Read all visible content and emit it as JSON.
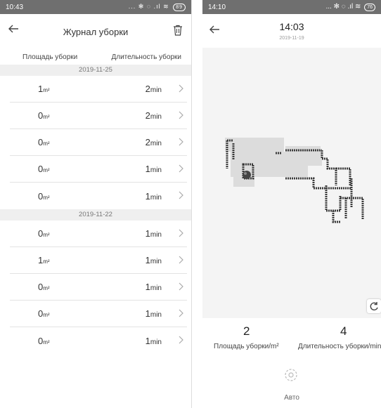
{
  "left_screen": {
    "status_time": "10:43",
    "status_icons": "... ✻ ◌ .ıl ≋",
    "battery": "89",
    "title": "Журнал уборки",
    "col_area": "Площадь уборки",
    "col_duration": "Длительность уборки",
    "groups": [
      {
        "date": "2019-11-25",
        "rows": [
          {
            "area": "1",
            "area_unit": "m²",
            "duration": "2",
            "duration_unit": "min"
          },
          {
            "area": "0",
            "area_unit": "m²",
            "duration": "2",
            "duration_unit": "min"
          },
          {
            "area": "0",
            "area_unit": "m²",
            "duration": "2",
            "duration_unit": "min"
          },
          {
            "area": "0",
            "area_unit": "m²",
            "duration": "1",
            "duration_unit": "min"
          },
          {
            "area": "0",
            "area_unit": "m²",
            "duration": "1",
            "duration_unit": "min"
          }
        ]
      },
      {
        "date": "2019-11-22",
        "rows": [
          {
            "area": "0",
            "area_unit": "m²",
            "duration": "1",
            "duration_unit": "min"
          },
          {
            "area": "1",
            "area_unit": "m²",
            "duration": "1",
            "duration_unit": "min"
          },
          {
            "area": "0",
            "area_unit": "m²",
            "duration": "1",
            "duration_unit": "min"
          },
          {
            "area": "0",
            "area_unit": "m²",
            "duration": "1",
            "duration_unit": "min"
          },
          {
            "area": "0",
            "area_unit": "m²",
            "duration": "1",
            "duration_unit": "min"
          }
        ]
      }
    ]
  },
  "right_screen": {
    "status_time": "14:10",
    "status_icons": "... ✻ ◌ .ıl ≋",
    "battery": "76",
    "time": "14:03",
    "date": "2019-11-19",
    "area_value": "2",
    "area_label": "Площадь уборки/m²",
    "duration_value": "4",
    "duration_label": "Длительность уборки/min",
    "mode_label": "Авто"
  }
}
